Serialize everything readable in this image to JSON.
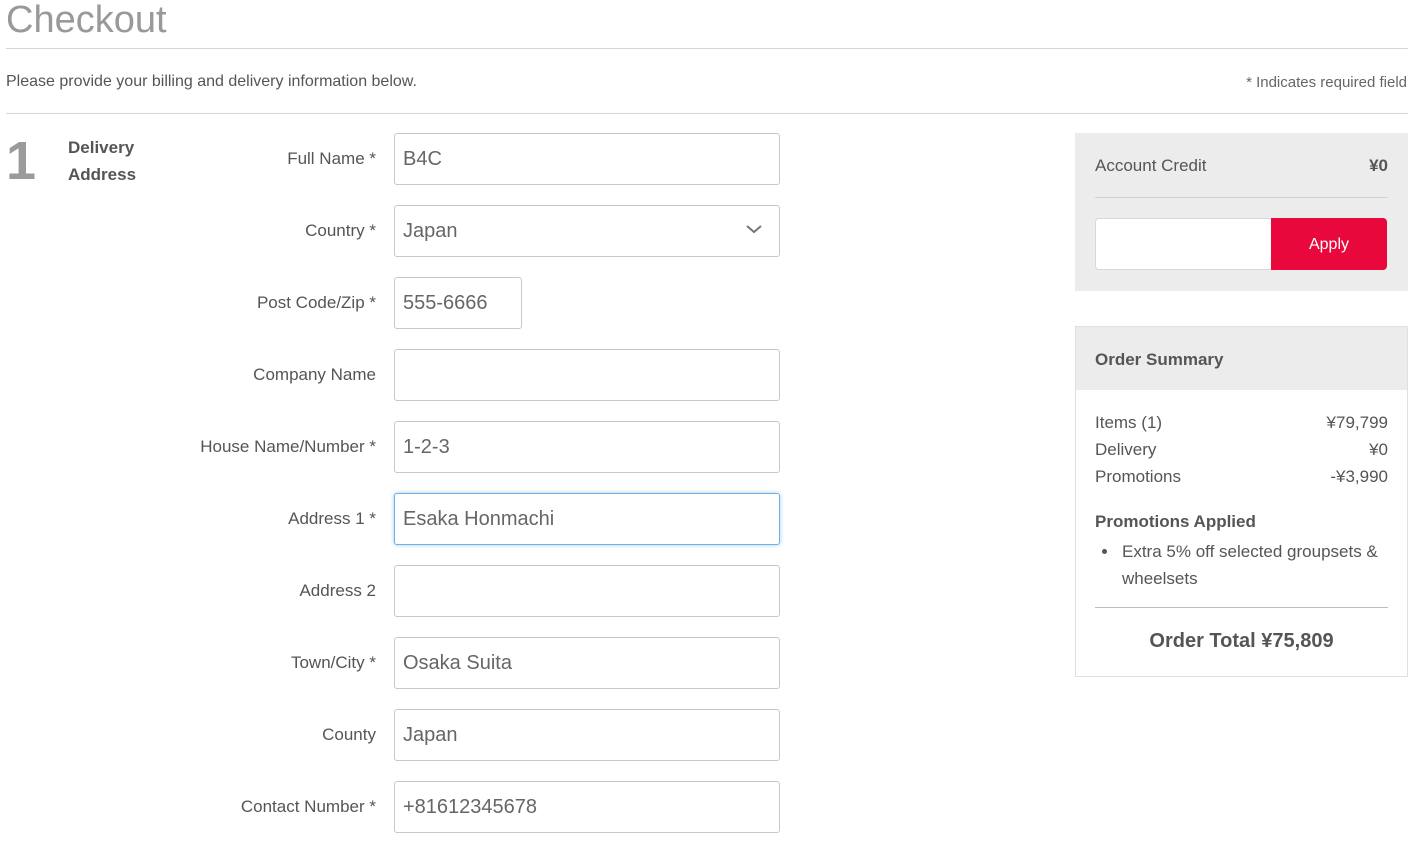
{
  "page": {
    "title": "Checkout",
    "intro": "Please provide your billing and delivery information below.",
    "required_note": "* Indicates required field"
  },
  "step": {
    "number": "1",
    "title_line1": "Delivery",
    "title_line2": "Address"
  },
  "form": {
    "full_name": {
      "label": "Full Name *",
      "value": "B4C"
    },
    "country": {
      "label": "Country *",
      "value": "Japan"
    },
    "post_code": {
      "label": "Post Code/Zip *",
      "value": "555-6666"
    },
    "company_name": {
      "label": "Company Name",
      "value": ""
    },
    "house_number": {
      "label": "House Name/Number *",
      "value": "1-2-3"
    },
    "address1": {
      "label": "Address 1 *",
      "value": "Esaka Honmachi"
    },
    "address2": {
      "label": "Address 2",
      "value": ""
    },
    "town_city": {
      "label": "Town/City *",
      "value": "Osaka Suita"
    },
    "county": {
      "label": "County",
      "value": "Japan"
    },
    "contact_number": {
      "label": "Contact Number *",
      "value": "+81612345678"
    }
  },
  "credit": {
    "label": "Account Credit",
    "value": "¥0",
    "input_value": "",
    "apply_label": "Apply"
  },
  "summary": {
    "title": "Order Summary",
    "lines": [
      {
        "label": "Items (1)",
        "value": "¥79,799"
      },
      {
        "label": "Delivery",
        "value": "¥0"
      },
      {
        "label": "Promotions",
        "value": "-¥3,990"
      }
    ],
    "promotions_title": "Promotions Applied",
    "promotions": [
      "Extra 5% off selected groupsets & wheelsets"
    ],
    "total": "Order Total ¥75,809"
  },
  "colors": {
    "accent": "#e8083b",
    "focus": "#6fb1e6",
    "panel_bg": "#ececec"
  },
  "icons": {
    "country_dropdown": "chevron-down-icon"
  }
}
